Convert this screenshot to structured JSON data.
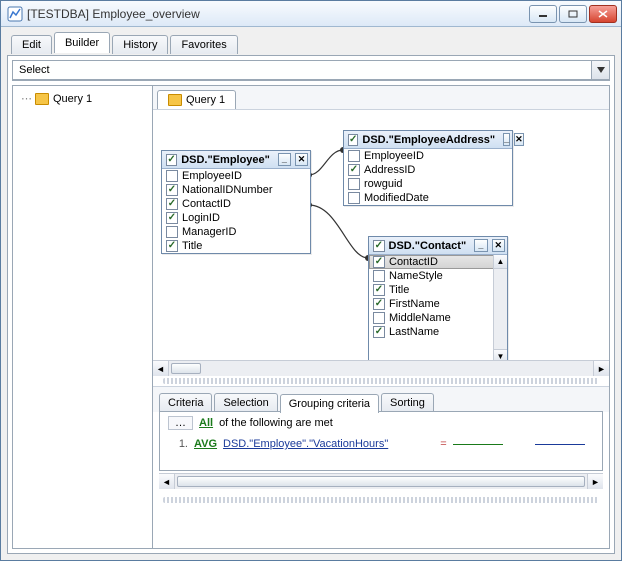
{
  "window": {
    "title": "[TESTDBA] Employee_overview"
  },
  "tabs": {
    "edit": "Edit",
    "builder": "Builder",
    "history": "History",
    "favorites": "Favorites",
    "active": "Builder"
  },
  "select_label": "Select",
  "tree": {
    "item1": "Query 1"
  },
  "query_tab": "Query 1",
  "tables": {
    "employee": {
      "title": "DSD.\"Employee\"",
      "cols": [
        {
          "name": "EmployeeID",
          "checked": false
        },
        {
          "name": "NationalIDNumber",
          "checked": true
        },
        {
          "name": "ContactID",
          "checked": true
        },
        {
          "name": "LoginID",
          "checked": true
        },
        {
          "name": "ManagerID",
          "checked": false
        },
        {
          "name": "Title",
          "checked": true
        }
      ]
    },
    "employee_address": {
      "title": "DSD.\"EmployeeAddress\"",
      "cols": [
        {
          "name": "EmployeeID",
          "checked": false
        },
        {
          "name": "AddressID",
          "checked": true
        },
        {
          "name": "rowguid",
          "checked": false
        },
        {
          "name": "ModifiedDate",
          "checked": false
        }
      ]
    },
    "contact": {
      "title": "DSD.\"Contact\"",
      "cols": [
        {
          "name": "ContactID",
          "checked": true
        },
        {
          "name": "NameStyle",
          "checked": false
        },
        {
          "name": "Title",
          "checked": true
        },
        {
          "name": "FirstName",
          "checked": true
        },
        {
          "name": "MiddleName",
          "checked": false
        },
        {
          "name": "LastName",
          "checked": true
        }
      ]
    }
  },
  "subtabs": {
    "criteria": "Criteria",
    "selection": "Selection",
    "grouping": "Grouping criteria",
    "sorting": "Sorting",
    "active": "Grouping criteria"
  },
  "criteria": {
    "header_all": "All",
    "header_rest": "of the following are met",
    "row1_idx": "1.",
    "row1_func": "AVG",
    "row1_col": "DSD.\"Employee\".\"VacationHours\"",
    "row1_op": "="
  }
}
